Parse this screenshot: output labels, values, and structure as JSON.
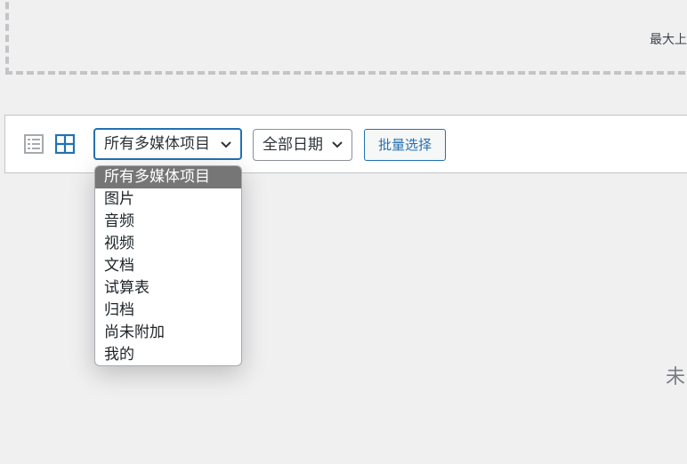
{
  "upload": {
    "max_size_label": "最大上"
  },
  "toolbar": {
    "list_view_icon": "list-view-icon",
    "grid_view_icon": "grid-view-icon",
    "media_type_filter": {
      "selected": "所有多媒体项目",
      "options": [
        "所有多媒体项目",
        "图片",
        "音频",
        "视频",
        "文档",
        "试算表",
        "归档",
        "尚未附加",
        "我的"
      ]
    },
    "date_filter": {
      "selected": "全部日期"
    },
    "bulk_select_label": "批量选择"
  },
  "main": {
    "empty_text": "未"
  },
  "colors": {
    "accent": "#2271b1",
    "selected_option_bg": "#767676",
    "background": "#f0f0f1"
  }
}
